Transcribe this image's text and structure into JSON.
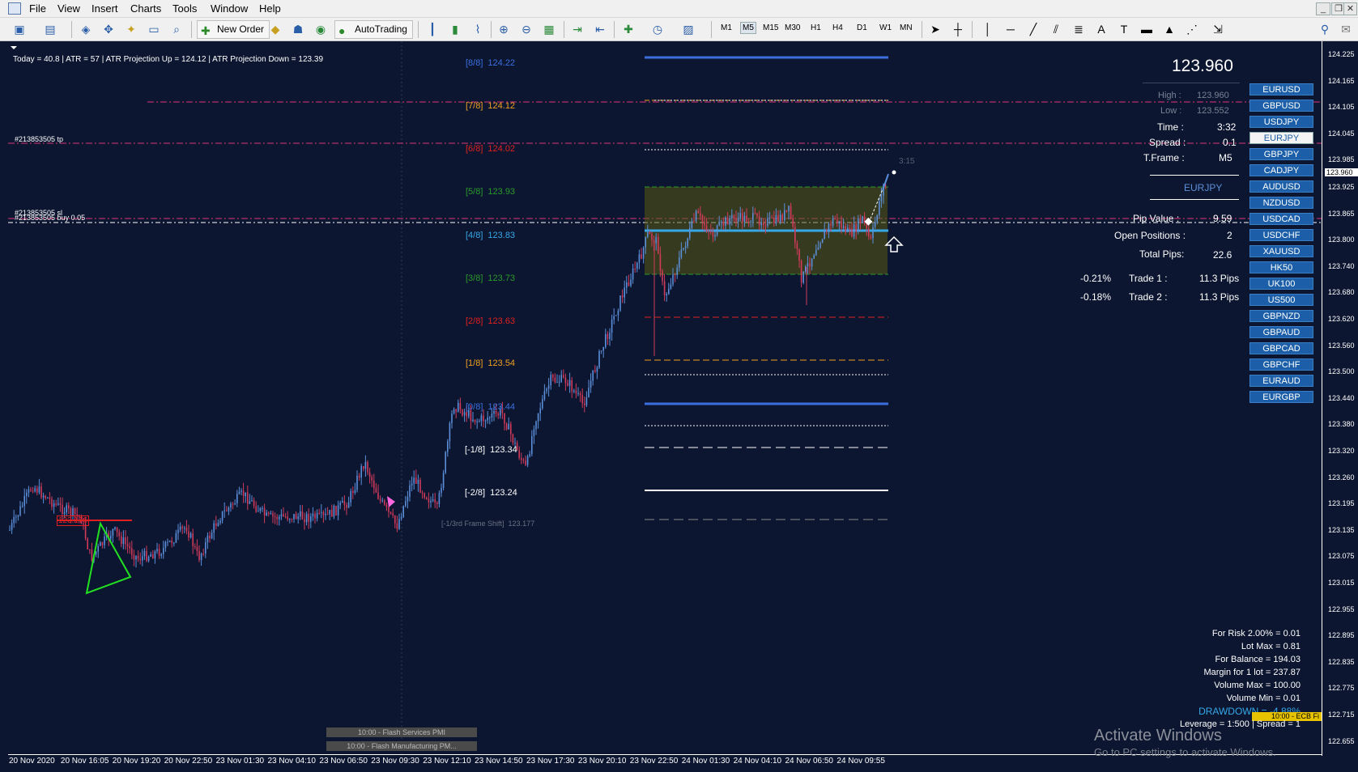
{
  "menu": {
    "items": [
      "File",
      "View",
      "Insert",
      "Charts",
      "Tools",
      "Window",
      "Help"
    ]
  },
  "toolbar": {
    "new_order_label": "New Order",
    "autotrading_label": "AutoTrading",
    "timeframes": [
      "M1",
      "M5",
      "M15",
      "M30",
      "H1",
      "H4",
      "D1",
      "W1",
      "MN"
    ],
    "active_timeframe": "M5"
  },
  "chart": {
    "info_line": "Today = 40.8   |   ATR = 57   |   ATR Projection Up = 124.12   |   ATR Projection Down = 123.39",
    "tp_label": "#213853505 tp",
    "sl_label": "#213853505 sl",
    "buy_label": "#213853505 buy 0.05",
    "pivot_label": "123.176",
    "countdown": "3:15",
    "murrey_levels": [
      {
        "label": "[8/8]",
        "value": "124.22",
        "color": "#3b6fe0"
      },
      {
        "label": "[7/8]",
        "value": "124.12",
        "color": "#f0a020"
      },
      {
        "label": "[6/8]",
        "value": "124.02",
        "color": "#e02020"
      },
      {
        "label": "[5/8]",
        "value": "123.93",
        "color": "#2a9a2a"
      },
      {
        "label": "[4/8]",
        "value": "123.83",
        "color": "#36a8e8"
      },
      {
        "label": "[3/8]",
        "value": "123.73",
        "color": "#2a9a2a"
      },
      {
        "label": "[2/8]",
        "value": "123.63",
        "color": "#e02020"
      },
      {
        "label": "[1/8]",
        "value": "123.54",
        "color": "#f0a020"
      },
      {
        "label": "[0/8]",
        "value": "123.44",
        "color": "#3b6fe0"
      },
      {
        "label": "[-1/8]",
        "value": "123.34",
        "color": "#ffffff"
      },
      {
        "label": "[-2/8]",
        "value": "123.24",
        "color": "#ffffff"
      }
    ],
    "frame_shift_label": "[-1/3rd Frame Shift]",
    "frame_shift_value": "123.177"
  },
  "panel": {
    "price": "123.960",
    "high_label": "High :",
    "high_value": "123.960",
    "low_label": "Low :",
    "low_value": "123.552",
    "time_label": "Time :",
    "time_value": "3:32",
    "spread_label": "Spread :",
    "spread_value": "0.1",
    "tframe_label": "T.Frame :",
    "tframe_value": "M5",
    "symbol": "EURJPY",
    "pip_value_label": "Pip Value :",
    "pip_value": "9.59",
    "open_positions_label": "Open Positions :",
    "open_positions": "2",
    "total_pips_label": "Total Pips:",
    "total_pips": "22.6",
    "trades": [
      {
        "pct": "-0.21%",
        "label": "Trade 1 :",
        "pips": "11.3 Pips"
      },
      {
        "pct": "-0.18%",
        "label": "Trade 2 :",
        "pips": "11.3 Pips"
      }
    ]
  },
  "symbols": [
    "EURUSD",
    "GBPUSD",
    "USDJPY",
    "EURJPY",
    "GBPJPY",
    "CADJPY",
    "AUDUSD",
    "NZDUSD",
    "USDCAD",
    "USDCHF",
    "XAUUSD",
    "HK50",
    "UK100",
    "US500",
    "GBPNZD",
    "GBPAUD",
    "GBPCAD",
    "GBPCHF",
    "EURAUD",
    "EURGBP"
  ],
  "active_symbol": "EURJPY",
  "price_axis": [
    "124.225",
    "124.165",
    "124.105",
    "124.045",
    "123.985",
    "123.960",
    "123.925",
    "123.865",
    "123.800",
    "123.740",
    "123.680",
    "123.620",
    "123.560",
    "123.500",
    "123.440",
    "123.380",
    "123.320",
    "123.260",
    "123.195",
    "123.135",
    "123.075",
    "123.015",
    "122.955",
    "122.895",
    "122.835",
    "122.775",
    "122.715",
    "122.655"
  ],
  "time_axis": [
    "20 Nov 2020",
    "20 Nov 16:05",
    "20 Nov 19:20",
    "20 Nov 22:50",
    "23 Nov 01:30",
    "23 Nov 04:10",
    "23 Nov 06:50",
    "23 Nov 09:30",
    "23 Nov 12:10",
    "23 Nov 14:50",
    "23 Nov 17:30",
    "23 Nov 20:10",
    "23 Nov 22:50",
    "24 Nov 01:30",
    "24 Nov 04:10",
    "24 Nov 06:50",
    "24 Nov 09:55"
  ],
  "risk": {
    "lines": [
      "For Risk 2.00% = 0.01",
      "Lot Max = 0.81",
      "For Balance = 194.03",
      "Margin for 1 lot = 237.87",
      "Volume Max = 100.00",
      "Volume Min = 0.01"
    ],
    "drawdown": "DRAWDOWN = -4.88%",
    "leverage": "Leverage = 1:500 | Spread = 1",
    "news_badge": "10:00 - ECB Fi"
  },
  "news": [
    "10:00 - Flash Services PMI",
    "10:00 - Flash Manufacturing PM..."
  ],
  "watermark": {
    "title": "Activate Windows",
    "subtitle": "Go to PC settings to activate Windows."
  },
  "colors": {
    "background": "#0c1630",
    "bull": "#5b8fd9",
    "bear": "#d23a5a",
    "button": "#1c5fa8"
  }
}
